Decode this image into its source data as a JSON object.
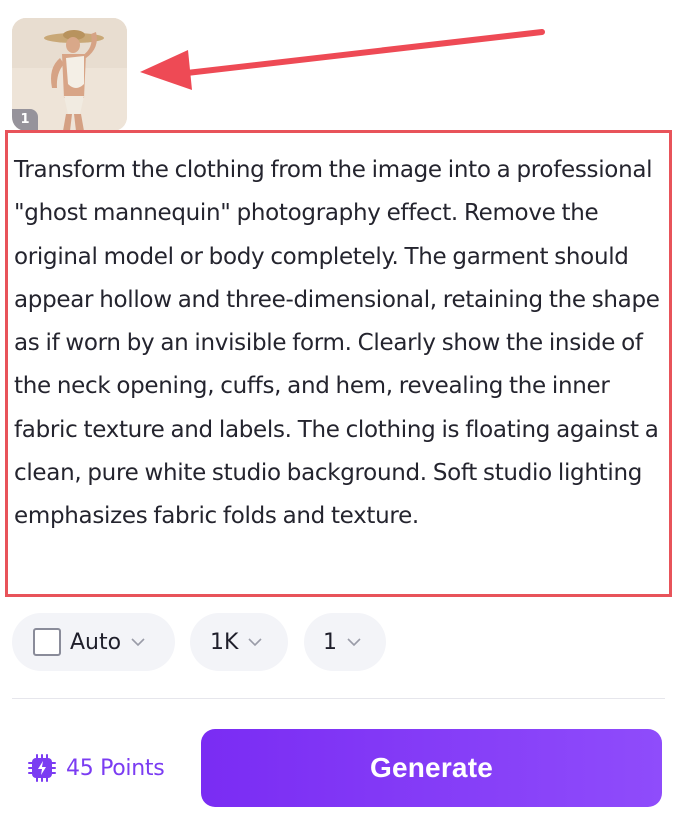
{
  "reference_image": {
    "badge": "1",
    "alt": "model photo"
  },
  "prompt": {
    "text": "Transform the clothing from the image into a professional \"ghost mannequin\" photography effect. Remove the original model or body completely. The garment should appear hollow and three-dimensional, retaining the shape as if worn by an invisible form. Clearly show the inside of the neck opening, cuffs, and hem, revealing the inner fabric texture and labels. The clothing is floating against a clean, pure white studio background. Soft studio lighting emphasizes fabric folds and texture."
  },
  "options": {
    "aspect": {
      "label": "Auto",
      "icon": "aspect-ratio-square-icon"
    },
    "resolution": {
      "label": "1K"
    },
    "count": {
      "label": "1"
    }
  },
  "footer": {
    "points_label": "45 Points",
    "points_icon": "chip-icon",
    "generate_label": "Generate"
  },
  "colors": {
    "accent": "#7b3cf2",
    "highlight_border": "#e8535a",
    "arrow": "#ee4a55"
  }
}
